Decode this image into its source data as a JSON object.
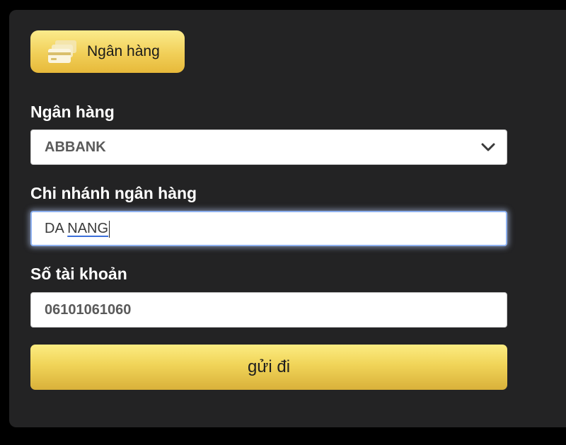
{
  "tab": {
    "label": "Ngân hàng",
    "icon": "bank-card-icon"
  },
  "form": {
    "bank": {
      "label": "Ngân hàng",
      "value": "ABBANK"
    },
    "branch": {
      "label": "Chi nhánh ngân hàng",
      "value_part1": "DA ",
      "value_part2": "NANG"
    },
    "account": {
      "label": "Số tài khoản",
      "value": "06101061060"
    },
    "submit_label": "gửi đi"
  },
  "colors": {
    "background": "#000000",
    "panel": "#232324",
    "gold_light": "#fbeb8c",
    "gold_dark": "#e7b93a",
    "focus_border": "#8fb2f0"
  }
}
